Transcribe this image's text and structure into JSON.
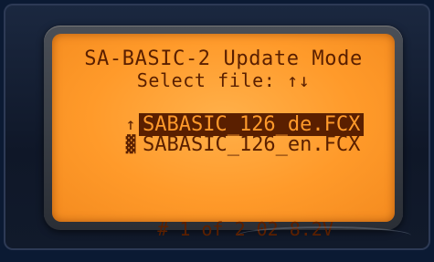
{
  "header": {
    "title": "SA-BASIC-2 Update Mode",
    "subtitle": "Select file: ↑↓"
  },
  "files": [
    {
      "marker": "↑",
      "name": "SABASIC_126_de.FCX",
      "selected": true
    },
    {
      "marker": "▓",
      "name": "SABASIC_126_en.FCX",
      "selected": false
    }
  ],
  "status": {
    "position": "# 1 of 2",
    "version": "02",
    "voltage": "8.2V"
  },
  "colors": {
    "screen_background": "#ff9a2a",
    "text": "#5a1f00"
  }
}
